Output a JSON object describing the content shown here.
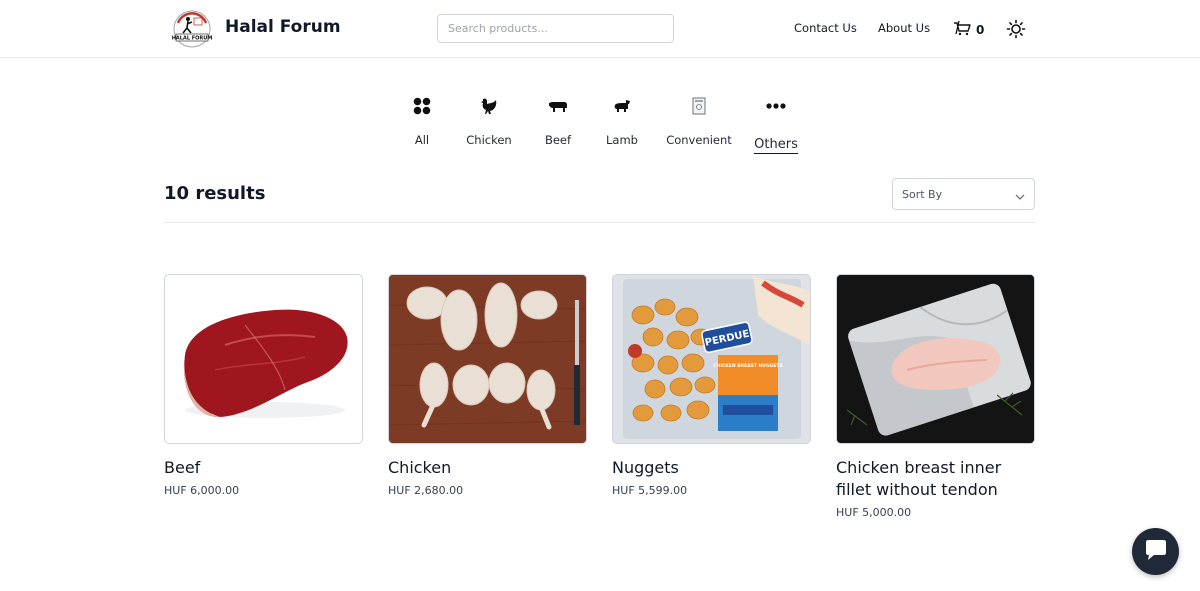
{
  "header": {
    "brand": "Halal Forum",
    "logo_text": "HALAL FORUM",
    "search_placeholder": "Search products...",
    "nav": {
      "contact": "Contact Us",
      "about": "About Us"
    },
    "cart_count": "0"
  },
  "categories": [
    {
      "label": "All",
      "icon": "grid-icon"
    },
    {
      "label": "Chicken",
      "icon": "chicken-icon"
    },
    {
      "label": "Beef",
      "icon": "cow-icon"
    },
    {
      "label": "Lamb",
      "icon": "lamb-icon"
    },
    {
      "label": "Convenient",
      "icon": "package-icon"
    },
    {
      "label": "Others",
      "icon": "more-icon",
      "active": true
    }
  ],
  "results": {
    "count_label": "10 results"
  },
  "sort": {
    "label": "Sort By"
  },
  "products": [
    {
      "name": "Beef",
      "price": "HUF 6,000.00"
    },
    {
      "name": "Chicken",
      "price": "HUF 2,680.00"
    },
    {
      "name": "Nuggets",
      "price": "HUF 5,599.00",
      "package_brand": "PERDUE",
      "package_title": "CHICKEN BREAST NUGGETS"
    },
    {
      "name": "Chicken breast inner fillet without tendon",
      "price": "HUF 5,000.00"
    }
  ],
  "colors": {
    "text": "#111827",
    "border": "#d1d5db",
    "chat_bg": "#1f2937"
  }
}
